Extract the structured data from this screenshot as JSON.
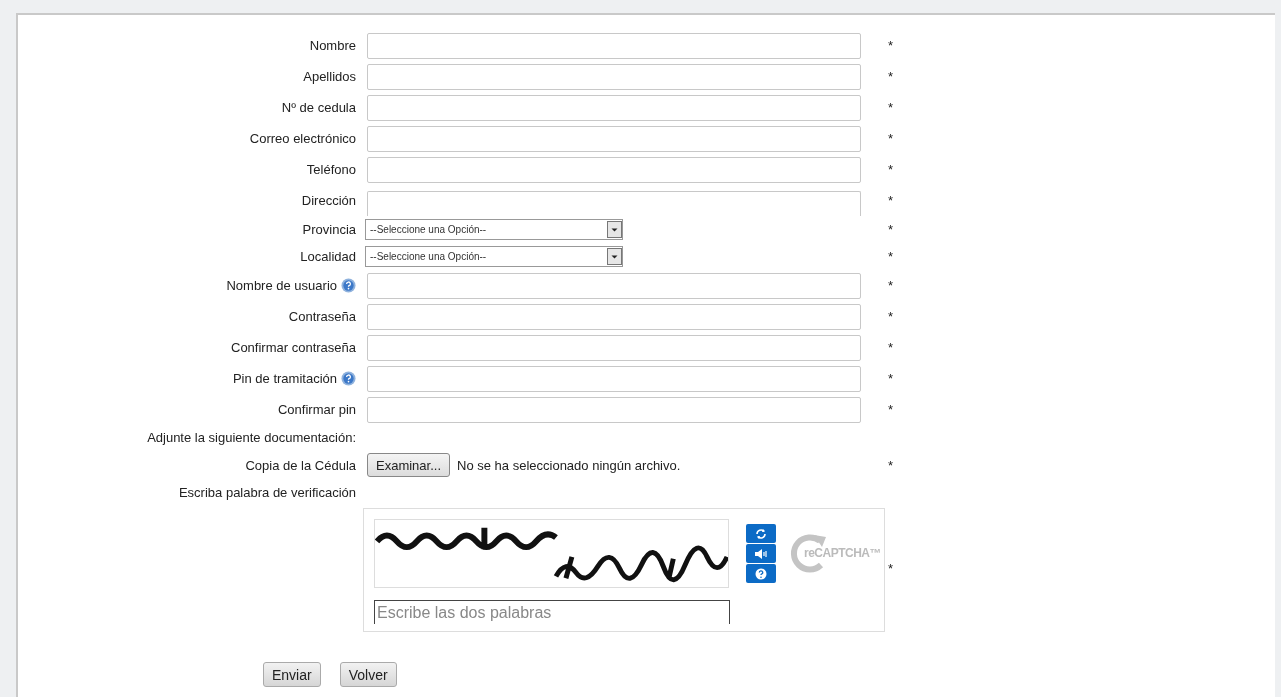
{
  "fields": [
    {
      "kind": "text",
      "label": "Nombre",
      "help": false,
      "mark": "*"
    },
    {
      "kind": "text",
      "label": "Apellidos",
      "help": false,
      "mark": "*"
    },
    {
      "kind": "text",
      "label": "Nº de cedula",
      "help": false,
      "mark": "*"
    },
    {
      "kind": "text",
      "label": "Correo electrónico",
      "help": false,
      "mark": "*"
    },
    {
      "kind": "text",
      "label": "Teléfono",
      "help": false,
      "mark": "*"
    },
    {
      "kind": "cut",
      "label": "Dirección",
      "help": false,
      "mark": "*"
    },
    {
      "kind": "select",
      "label": "Provincia",
      "value": "--Seleccione una Opción--",
      "help": false,
      "mark": "*"
    },
    {
      "kind": "select",
      "label": "Localidad",
      "value": "--Seleccione una Opción--",
      "help": false,
      "mark": "*"
    },
    {
      "kind": "text",
      "label": "Nombre de usuario",
      "help": true,
      "mark": "*"
    },
    {
      "kind": "text",
      "label": "Contraseña",
      "help": false,
      "mark": "*"
    },
    {
      "kind": "text",
      "label": "Confirmar contraseña",
      "help": false,
      "mark": "*"
    },
    {
      "kind": "text",
      "label": "Pin de tramitación",
      "help": true,
      "mark": "*"
    },
    {
      "kind": "text",
      "label": "Confirmar pin",
      "help": false,
      "mark": "*"
    },
    {
      "kind": "heading",
      "label": "Adjunte la siguiente documentación:"
    },
    {
      "kind": "file",
      "label": "Copia de la Cédula",
      "button": "Examinar...",
      "status": "No se ha seleccionado ningún archivo.",
      "mark": "*"
    },
    {
      "kind": "heading",
      "label": "Escriba palabra de verificación"
    },
    {
      "kind": "captcha",
      "placeholder": "Escribe las dos palabras",
      "logo": "reCAPTCHA™",
      "mark": "*"
    }
  ],
  "buttons": [
    "Enviar",
    "Volver"
  ]
}
